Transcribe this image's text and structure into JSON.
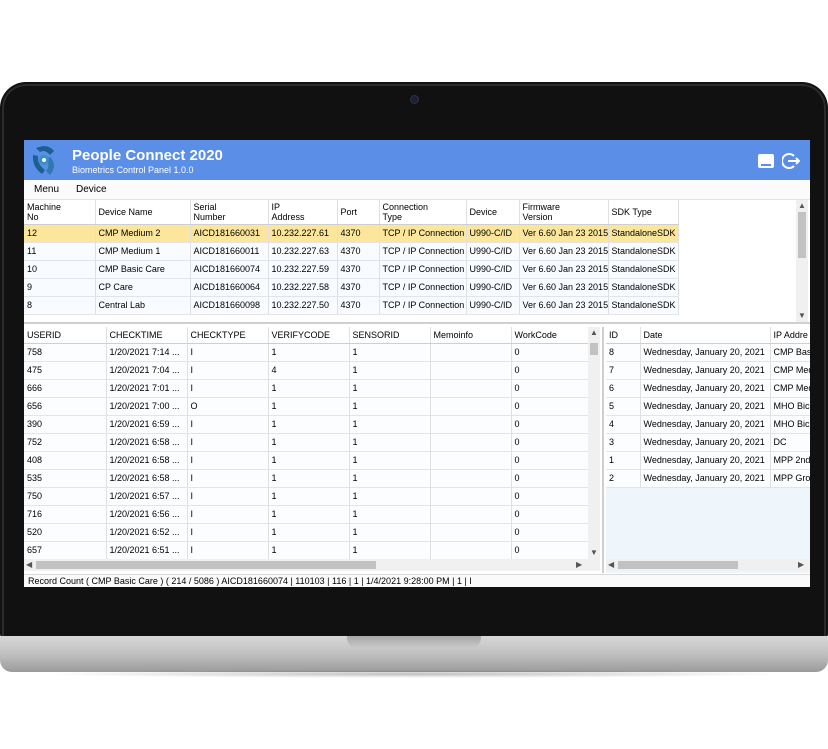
{
  "app": {
    "title": "People Connect 2020",
    "subtitle": "Biometrics Control Panel 1.0.0",
    "colors": {
      "titlebar": "#5b8ee6",
      "selected_row": "#fbe69b"
    }
  },
  "menu": {
    "items": [
      "Menu",
      "Device"
    ]
  },
  "devices": {
    "headers": [
      [
        "Machine",
        "No"
      ],
      [
        "Device Name",
        ""
      ],
      [
        "Serial",
        "Number"
      ],
      [
        "IP",
        "Address"
      ],
      [
        "Port",
        ""
      ],
      [
        "Connection",
        "Type"
      ],
      [
        "Device",
        ""
      ],
      [
        "Firmware",
        "Version"
      ],
      [
        "SDK Type",
        ""
      ]
    ],
    "rows": [
      [
        "12",
        "CMP Medium 2",
        "AICD181660031",
        "10.232.227.61",
        "4370",
        "TCP / IP Connection",
        "U990-C/ID",
        "Ver 6.60 Jan 23 2015",
        "StandaloneSDK"
      ],
      [
        "11",
        "CMP Medium 1",
        "AICD181660011",
        "10.232.227.63",
        "4370",
        "TCP / IP Connection",
        "U990-C/ID",
        "Ver 6.60 Jan 23 2015",
        "StandaloneSDK"
      ],
      [
        "10",
        "CMP Basic Care",
        "AICD181660074",
        "10.232.227.59",
        "4370",
        "TCP / IP Connection",
        "U990-C/ID",
        "Ver 6.60 Jan 23 2015",
        "StandaloneSDK"
      ],
      [
        "9",
        "CP Care",
        "AICD181660064",
        "10.232.227.58",
        "4370",
        "TCP / IP Connection",
        "U990-C/ID",
        "Ver 6.60 Jan 23 2015",
        "StandaloneSDK"
      ],
      [
        "8",
        "Central Lab",
        "AICD181660098",
        "10.232.227.50",
        "4370",
        "TCP / IP Connection",
        "U990-C/ID",
        "Ver 6.60 Jan 23 2015",
        "StandaloneSDK"
      ]
    ],
    "selected_index": 0
  },
  "logs": {
    "headers": [
      "USERID",
      "CHECKTIME",
      "CHECKTYPE",
      "VERIFYCODE",
      "SENSORID",
      "Memoinfo",
      "WorkCode"
    ],
    "rows": [
      [
        "758",
        "1/20/2021 7:14 ...",
        "I",
        "1",
        "1",
        "",
        "0"
      ],
      [
        "475",
        "1/20/2021 7:04 ...",
        "I",
        "4",
        "1",
        "",
        "0"
      ],
      [
        "666",
        "1/20/2021 7:01 ...",
        "I",
        "1",
        "1",
        "",
        "0"
      ],
      [
        "656",
        "1/20/2021 7:00 ...",
        "O",
        "1",
        "1",
        "",
        "0"
      ],
      [
        "390",
        "1/20/2021 6:59 ...",
        "I",
        "1",
        "1",
        "",
        "0"
      ],
      [
        "752",
        "1/20/2021 6:58 ...",
        "I",
        "1",
        "1",
        "",
        "0"
      ],
      [
        "408",
        "1/20/2021 6:58 ...",
        "I",
        "1",
        "1",
        "",
        "0"
      ],
      [
        "535",
        "1/20/2021 6:58 ...",
        "I",
        "1",
        "1",
        "",
        "0"
      ],
      [
        "750",
        "1/20/2021 6:57 ...",
        "I",
        "1",
        "1",
        "",
        "0"
      ],
      [
        "716",
        "1/20/2021 6:56 ...",
        "I",
        "1",
        "1",
        "",
        "0"
      ],
      [
        "520",
        "1/20/2021 6:52 ...",
        "I",
        "1",
        "1",
        "",
        "0"
      ],
      [
        "657",
        "1/20/2021 6:51 ...",
        "I",
        "1",
        "1",
        "",
        "0"
      ]
    ]
  },
  "history": {
    "headers": [
      "ID",
      "Date",
      "IP Addre"
    ],
    "rows": [
      [
        "8",
        "Wednesday, January 20, 2021",
        "CMP Bas"
      ],
      [
        "7",
        "Wednesday, January 20, 2021",
        "CMP Med"
      ],
      [
        "6",
        "Wednesday, January 20, 2021",
        "CMP Med"
      ],
      [
        "5",
        "Wednesday, January 20, 2021",
        "MHO Bic"
      ],
      [
        "4",
        "Wednesday, January 20, 2021",
        "MHO Bic"
      ],
      [
        "3",
        "Wednesday, January 20, 2021",
        "DC"
      ],
      [
        "1",
        "Wednesday, January 20, 2021",
        "MPP 2nd"
      ],
      [
        "2",
        "Wednesday, January 20, 2021",
        "MPP Gro"
      ]
    ],
    "selected_index": 6
  },
  "status": {
    "text": "Record Count ( CMP Basic Care ) ( 214 / 5086 )  AICD181660074 | 110103 | 116 | 1 | 1/4/2021 9:28:00 PM | 1 | I"
  },
  "icons": {
    "logo": "fingerprint-logo-icon",
    "minimize": "minimize-icon",
    "logout": "logout-icon"
  }
}
